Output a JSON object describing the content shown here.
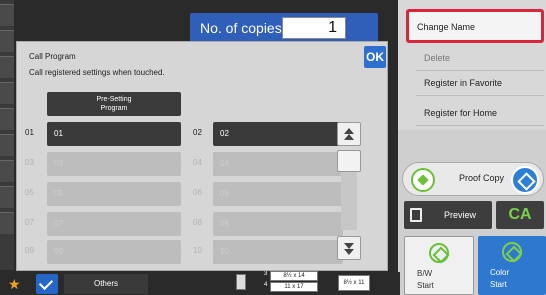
{
  "colors": {
    "accent_blue": "#2f6fd0",
    "highlight_red": "#d9253a",
    "start_green": "#7cd14c"
  },
  "copies": {
    "label": "No. of copies",
    "value": "1"
  },
  "menu": {
    "change_name": "Change Name",
    "delete": "Delete",
    "register_favorite": "Register in Favorite",
    "register_home": "Register for Home"
  },
  "dialog": {
    "title": "Call Program",
    "subtitle": "Call registered settings when touched.",
    "ok_label": "OK",
    "preset_label_line1": "Pre-Setting",
    "preset_label_line2": "Program",
    "programs": [
      {
        "num": "01",
        "label": "01"
      },
      {
        "num": "02",
        "label": "02"
      },
      {
        "num": "03",
        "label": "03"
      },
      {
        "num": "04",
        "label": "04"
      },
      {
        "num": "05",
        "label": "05"
      },
      {
        "num": "06",
        "label": "06"
      },
      {
        "num": "07",
        "label": "07"
      },
      {
        "num": "08",
        "label": "08"
      },
      {
        "num": "09",
        "label": "09"
      },
      {
        "num": "10",
        "label": "10"
      }
    ]
  },
  "right_panel": {
    "proof_copy": "Proof Copy",
    "preview": "Preview",
    "ca": "CA",
    "bw_start_line1": "B/W",
    "bw_start_line2": "Start",
    "color_start_line1": "Color",
    "color_start_line2": "Start"
  },
  "bottom": {
    "others": "Others",
    "paper_3": "3",
    "paper_4": "4",
    "paper_3_size": "8½ x 14",
    "paper_4_size": "11 x 17",
    "paper_main_size": "8½ x 11"
  },
  "icons": {
    "ok": "check-icon",
    "scroll_up": "double-chevron-up-icon",
    "scroll_down": "double-chevron-down-icon",
    "favorite": "star-icon",
    "proof": "diamond-icon",
    "preview": "document-icon"
  }
}
